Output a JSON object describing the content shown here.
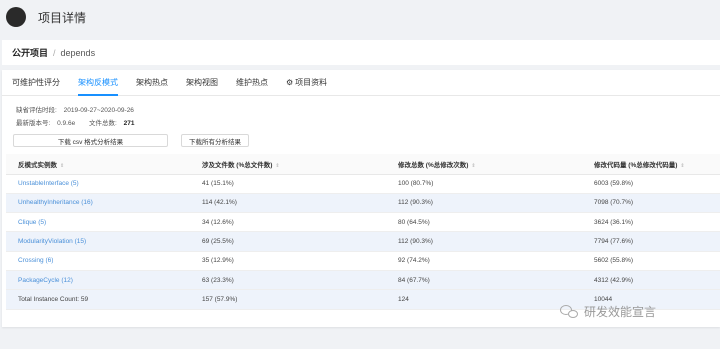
{
  "header": {
    "title": "项目详情"
  },
  "breadcrumb": {
    "root": "公开项目",
    "separator": "/",
    "current": "depends"
  },
  "tabs": [
    {
      "label": "可维护性评分",
      "active": false
    },
    {
      "label": "架构反模式",
      "active": true
    },
    {
      "label": "架构热点",
      "active": false
    },
    {
      "label": "架构视图",
      "active": false
    },
    {
      "label": "维护热点",
      "active": false
    },
    {
      "label": "项目资料",
      "active": false,
      "icon": "gear-icon"
    }
  ],
  "meta": {
    "period_label": "缺省评估时段:",
    "period_value": "2019-09-27~2020-09-26",
    "version_label": "最新版本号:",
    "version_value": "0.9.6e",
    "files_label": "文件总数:",
    "files_value": "271"
  },
  "buttons": {
    "download_csv": "下载 csv 格式分析结果",
    "download_all": "下载所有分析结果"
  },
  "table": {
    "headers": [
      "反模式实例数",
      "涉及文件数 (%总文件数)",
      "修改总数 (%总修改次数)",
      "修改代码量 (%总修改代码量)"
    ],
    "rows": [
      [
        "UnstableInterface (5)",
        "41 (15.1%)",
        "100 (80.7%)",
        "6003 (59.8%)"
      ],
      [
        "UnhealthyInheritance (16)",
        "114 (42.1%)",
        "112 (90.3%)",
        "7098 (70.7%)"
      ],
      [
        "Clique (5)",
        "34 (12.6%)",
        "80 (64.5%)",
        "3624 (36.1%)"
      ],
      [
        "ModularityViolation (15)",
        "69 (25.5%)",
        "112 (90.3%)",
        "7794 (77.6%)"
      ],
      [
        "Crossing (6)",
        "35 (12.9%)",
        "92 (74.2%)",
        "5602 (55.8%)"
      ],
      [
        "PackageCycle (12)",
        "63 (23.3%)",
        "84 (67.7%)",
        "4312 (42.9%)"
      ]
    ],
    "total": [
      "Total Instance Count: 59",
      "157 (57.9%)",
      "124",
      "10044"
    ]
  },
  "watermark": {
    "text": "研发效能宣言"
  },
  "colors": {
    "accent": "#1890ff",
    "link": "#4a90d9",
    "row_alt": "#eef3fb"
  }
}
